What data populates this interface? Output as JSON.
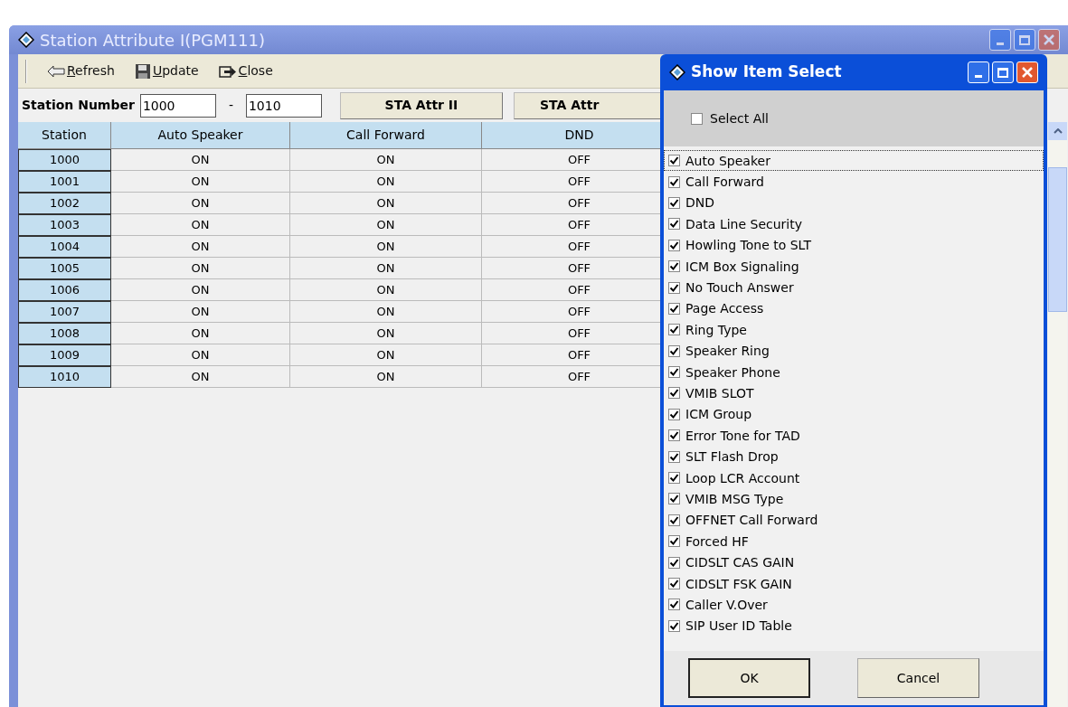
{
  "window": {
    "title": "Station Attribute I(PGM111)"
  },
  "toolbar": [
    {
      "label": "Refresh",
      "kind": "refresh"
    },
    {
      "label": "Update",
      "kind": "update"
    },
    {
      "label": "Close",
      "kind": "close"
    }
  ],
  "station_range": {
    "label": "Station Number",
    "from": "1000",
    "separator": "-",
    "to": "1010"
  },
  "attr_buttons": [
    "STA Attr II",
    "STA Attr"
  ],
  "table": {
    "columns": [
      "Station",
      "Auto Speaker",
      "Call Forward",
      "DND"
    ],
    "rows": [
      {
        "cells": [
          "1000",
          "ON",
          "ON",
          "OFF"
        ]
      },
      {
        "cells": [
          "1001",
          "ON",
          "ON",
          "OFF"
        ]
      },
      {
        "cells": [
          "1002",
          "ON",
          "ON",
          "OFF"
        ]
      },
      {
        "cells": [
          "1003",
          "ON",
          "ON",
          "OFF"
        ]
      },
      {
        "cells": [
          "1004",
          "ON",
          "ON",
          "OFF"
        ]
      },
      {
        "cells": [
          "1005",
          "ON",
          "ON",
          "OFF"
        ]
      },
      {
        "cells": [
          "1006",
          "ON",
          "ON",
          "OFF"
        ]
      },
      {
        "cells": [
          "1007",
          "ON",
          "ON",
          "OFF"
        ]
      },
      {
        "cells": [
          "1008",
          "ON",
          "ON",
          "OFF"
        ]
      },
      {
        "cells": [
          "1009",
          "ON",
          "ON",
          "OFF"
        ]
      },
      {
        "cells": [
          "1010",
          "ON",
          "ON",
          "OFF"
        ]
      }
    ]
  },
  "dialog": {
    "title": "Show Item Select",
    "select_all": {
      "label": "Select All",
      "checked": false
    },
    "items": [
      {
        "label": "Auto Speaker",
        "checked": true,
        "focused": true
      },
      {
        "label": "Call Forward",
        "checked": true,
        "focused": false
      },
      {
        "label": "DND",
        "checked": true,
        "focused": false
      },
      {
        "label": "Data Line Security",
        "checked": true,
        "focused": false
      },
      {
        "label": "Howling Tone to SLT",
        "checked": true,
        "focused": false
      },
      {
        "label": "ICM Box Signaling",
        "checked": true,
        "focused": false
      },
      {
        "label": "No Touch Answer",
        "checked": true,
        "focused": false
      },
      {
        "label": "Page Access",
        "checked": true,
        "focused": false
      },
      {
        "label": "Ring Type",
        "checked": true,
        "focused": false
      },
      {
        "label": "Speaker Ring",
        "checked": true,
        "focused": false
      },
      {
        "label": "Speaker Phone",
        "checked": true,
        "focused": false
      },
      {
        "label": "VMIB SLOT",
        "checked": true,
        "focused": false
      },
      {
        "label": "ICM Group",
        "checked": true,
        "focused": false
      },
      {
        "label": "Error Tone for TAD",
        "checked": true,
        "focused": false
      },
      {
        "label": "SLT Flash Drop",
        "checked": true,
        "focused": false
      },
      {
        "label": "Loop LCR Account",
        "checked": true,
        "focused": false
      },
      {
        "label": "VMIB MSG Type",
        "checked": true,
        "focused": false
      },
      {
        "label": "OFFNET Call Forward",
        "checked": true,
        "focused": false
      },
      {
        "label": "Forced HF",
        "checked": true,
        "focused": false
      },
      {
        "label": "CIDSLT CAS GAIN",
        "checked": true,
        "focused": false
      },
      {
        "label": "CIDSLT FSK GAIN",
        "checked": true,
        "focused": false
      },
      {
        "label": "Caller V.Over",
        "checked": true,
        "focused": false
      },
      {
        "label": "SIP User ID Table",
        "checked": true,
        "focused": false
      }
    ],
    "buttons": [
      "OK",
      "Cancel"
    ]
  }
}
